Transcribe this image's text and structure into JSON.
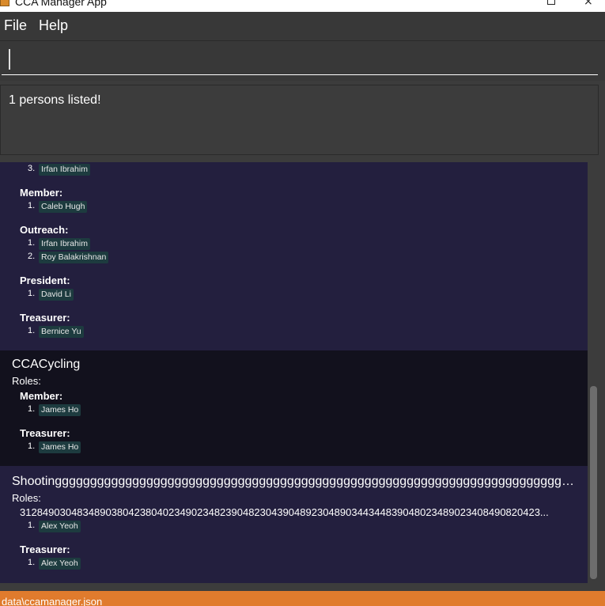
{
  "window": {
    "title": "CCA Manager App",
    "close_glyph": "×"
  },
  "menu": {
    "file": "File",
    "help": "Help"
  },
  "command": {
    "value": "",
    "placeholder": ""
  },
  "result": {
    "message": "1 persons listed!"
  },
  "cards": [
    {
      "name": "",
      "roles_label": "",
      "roles": [
        {
          "role": "",
          "members": [
            {
              "num": "3.",
              "name": "Irfan Ibrahim"
            }
          ]
        },
        {
          "role": "Member:",
          "members": [
            {
              "num": "1.",
              "name": "Caleb Hugh"
            }
          ]
        },
        {
          "role": "Outreach:",
          "members": [
            {
              "num": "1.",
              "name": "Irfan Ibrahim"
            },
            {
              "num": "2.",
              "name": "Roy Balakrishnan"
            }
          ]
        },
        {
          "role": "President:",
          "members": [
            {
              "num": "1.",
              "name": "David Li"
            }
          ]
        },
        {
          "role": "Treasurer:",
          "members": [
            {
              "num": "1.",
              "name": "Bernice Yu"
            }
          ]
        }
      ]
    },
    {
      "name": "CCACycling",
      "roles_label": "Roles:",
      "roles": [
        {
          "role": "Member:",
          "members": [
            {
              "num": "1.",
              "name": "James Ho"
            }
          ]
        },
        {
          "role": "Treasurer:",
          "members": [
            {
              "num": "1.",
              "name": "James Ho"
            }
          ]
        }
      ]
    },
    {
      "name": "Shootinggggggggggggggggggggggggggggggggggggggggggggggggggggggggggggggggggggggggggggggggggggggggg...",
      "roles_label": "Roles:",
      "roles": [
        {
          "role": "3128490304834890380423804023490234823904823043904892304890344344839048023489023408490820423...",
          "members": [
            {
              "num": "1.",
              "name": "Alex Yeoh"
            }
          ]
        },
        {
          "role": "Treasurer:",
          "members": [
            {
              "num": "1.",
              "name": "Alex Yeoh"
            }
          ]
        }
      ]
    }
  ],
  "status": {
    "path": "data\\ccamanager.json"
  }
}
